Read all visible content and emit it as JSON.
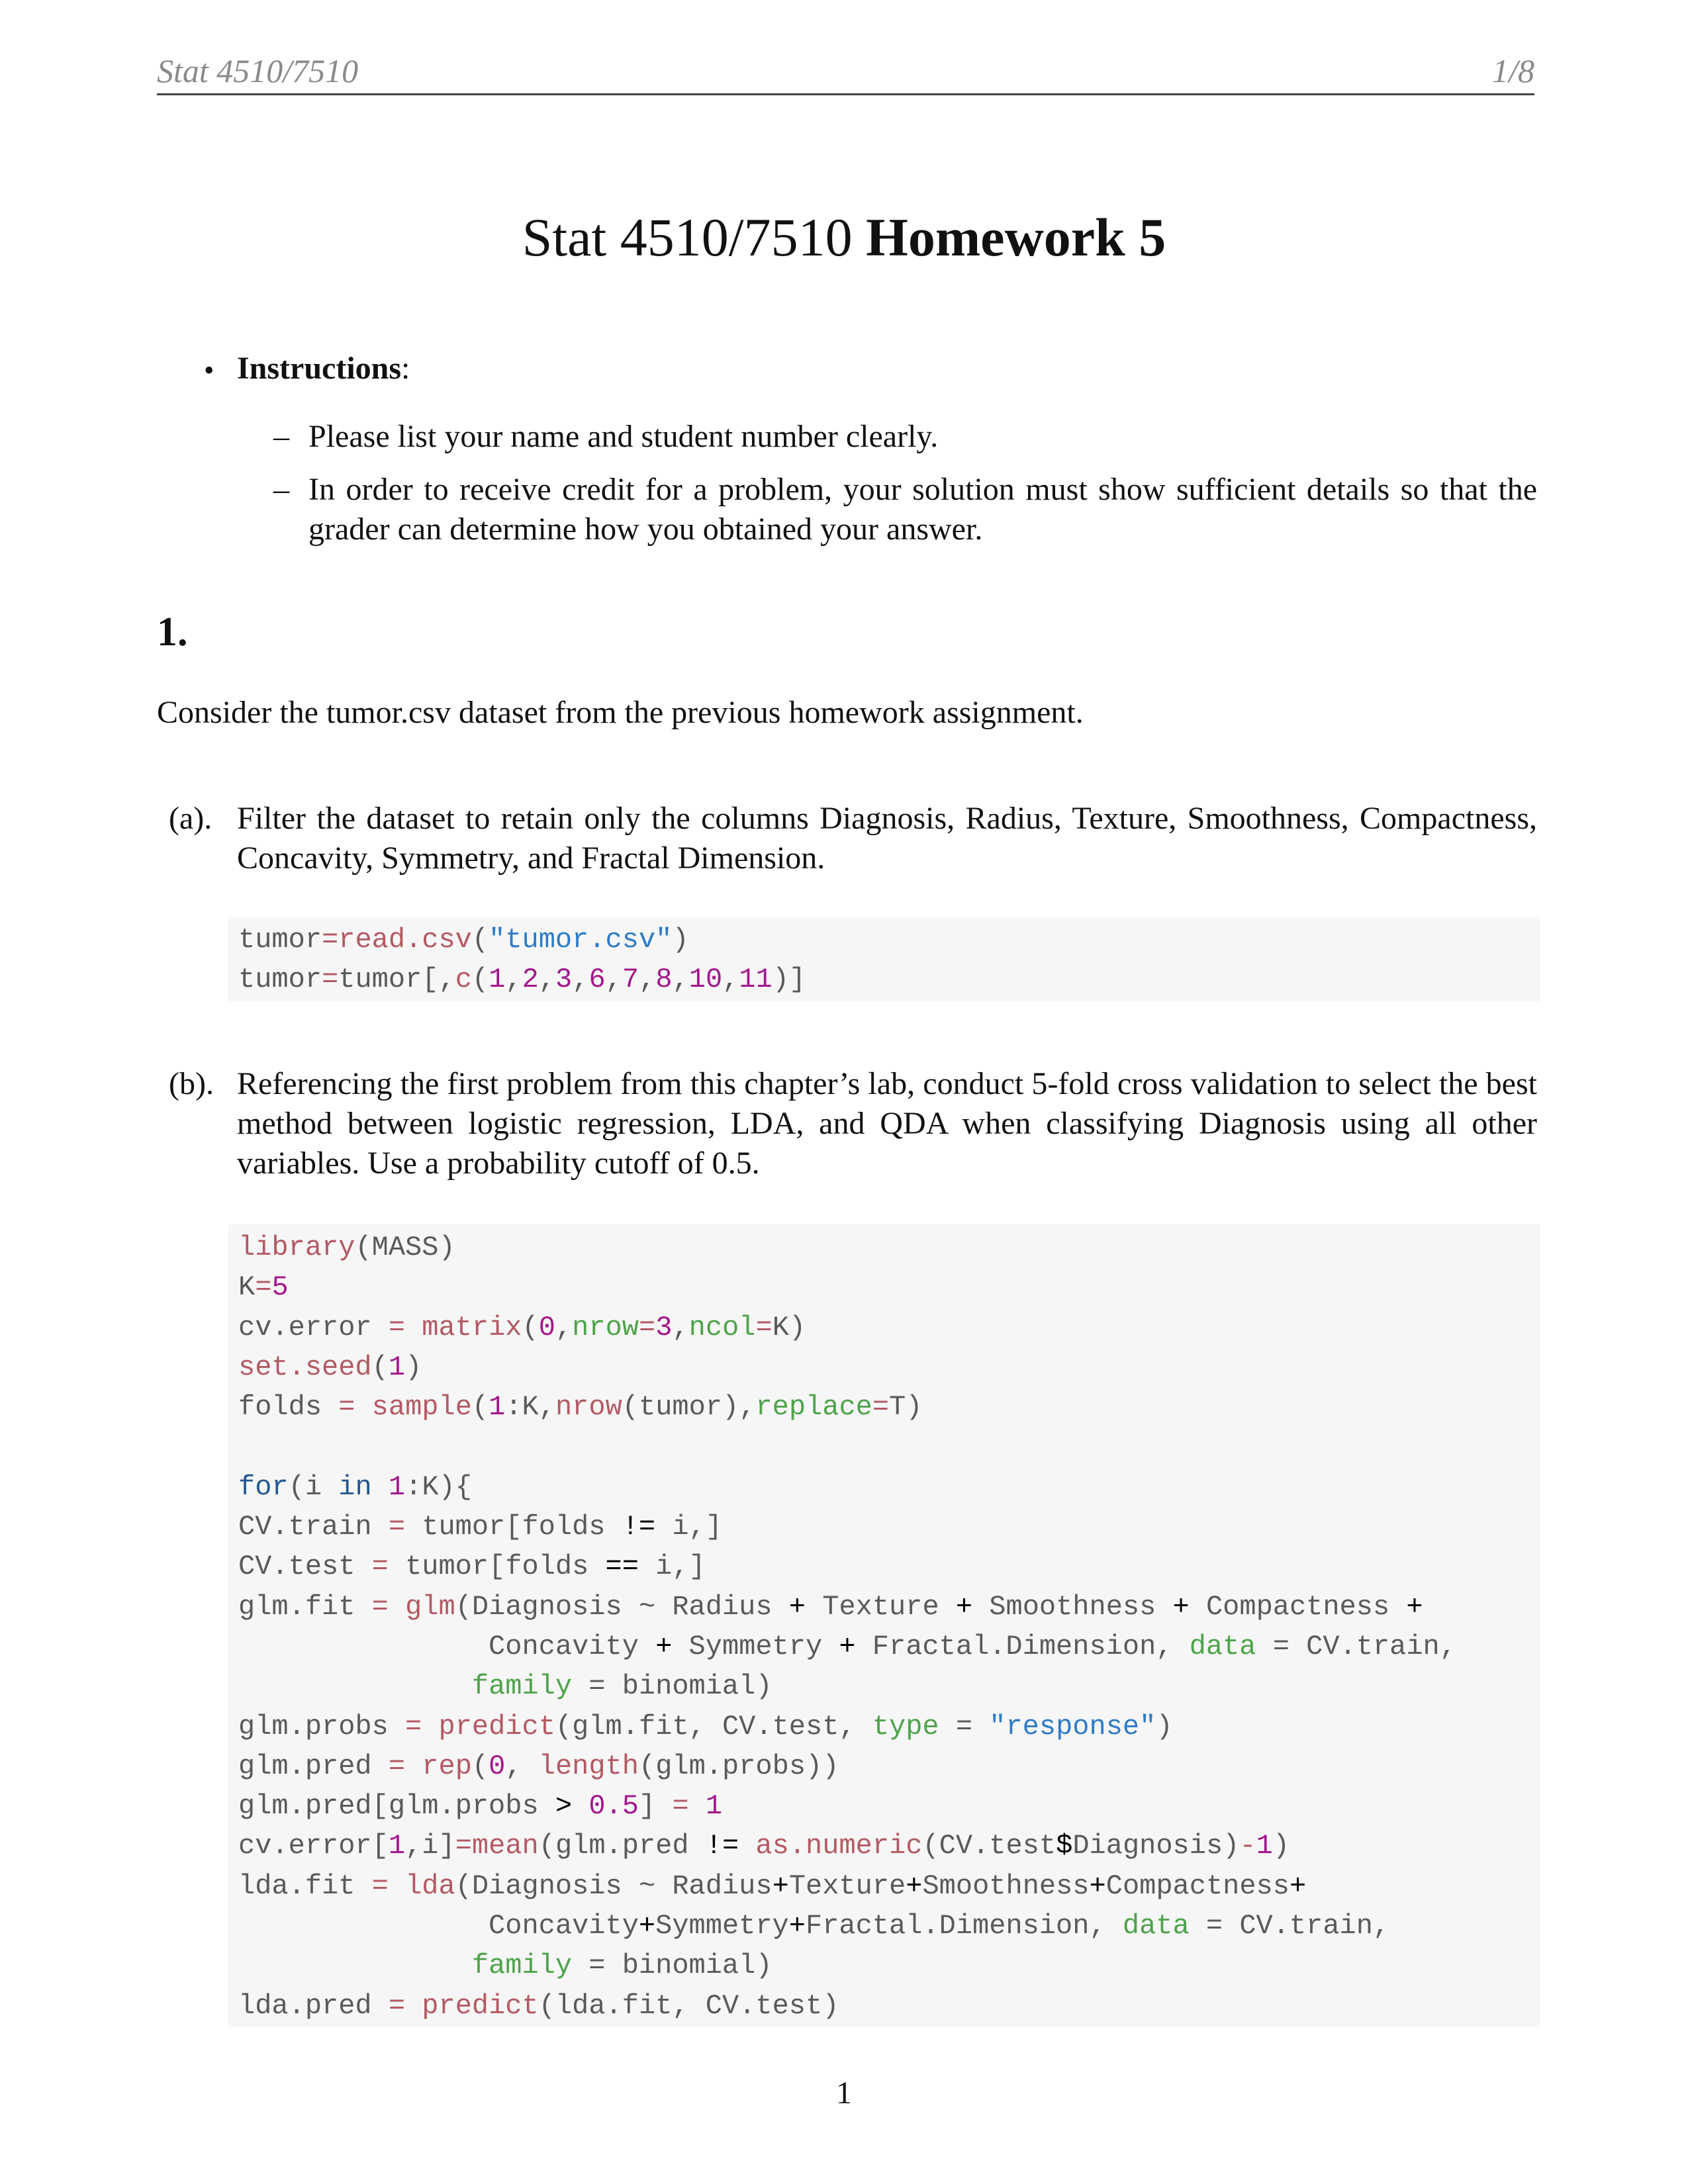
{
  "running_header": {
    "left": "Stat 4510/7510",
    "right": "1/8"
  },
  "title": {
    "course": "Stat 4510/7510",
    "assignment": "Homework 5"
  },
  "instructions": {
    "bullet": "•",
    "label": "Instructions",
    "label_suffix": ":",
    "dash": "–",
    "items": [
      "Please list your name and student number clearly.",
      "In order to receive credit for a problem, your solution must show sufficient details so that the grader can determine how you obtained your answer."
    ]
  },
  "question": {
    "number": "1.",
    "intro": "Consider the tumor.csv dataset from the previous homework assignment.",
    "parts": [
      {
        "label": "(a).",
        "text": "Filter the dataset to retain only the columns Diagnosis, Radius, Texture, Smoothness, Compactness, Concavity, Symmetry, and Fractal Dimension.",
        "code_lines": [
          [
            [
              "plain",
              "tumor"
            ],
            [
              "fn",
              "="
            ],
            [
              "fn",
              "read.csv"
            ],
            [
              "plain",
              "("
            ],
            [
              "str",
              "\"tumor.csv\""
            ],
            [
              "plain",
              ")"
            ]
          ],
          [
            [
              "plain",
              "tumor"
            ],
            [
              "fn",
              "="
            ],
            [
              "plain",
              "tumor[,"
            ],
            [
              "fn",
              "c"
            ],
            [
              "plain",
              "("
            ],
            [
              "num",
              "1"
            ],
            [
              "plain",
              ","
            ],
            [
              "num",
              "2"
            ],
            [
              "plain",
              ","
            ],
            [
              "num",
              "3"
            ],
            [
              "plain",
              ","
            ],
            [
              "num",
              "6"
            ],
            [
              "plain",
              ","
            ],
            [
              "num",
              "7"
            ],
            [
              "plain",
              ","
            ],
            [
              "num",
              "8"
            ],
            [
              "plain",
              ","
            ],
            [
              "num",
              "10"
            ],
            [
              "plain",
              ","
            ],
            [
              "num",
              "11"
            ],
            [
              "plain",
              ")]"
            ]
          ]
        ]
      },
      {
        "label": "(b).",
        "text": "Referencing the first problem from this chapter’s lab, conduct 5-fold cross validation to select the best method between logistic regression, LDA, and QDA when classifying Diagnosis using all other variables. Use a probability cutoff of 0.5.",
        "code_lines": [
          [
            [
              "fn",
              "library"
            ],
            [
              "plain",
              "(MASS)"
            ]
          ],
          [
            [
              "plain",
              "K"
            ],
            [
              "fn",
              "="
            ],
            [
              "num",
              "5"
            ]
          ],
          [
            [
              "plain",
              "cv.error "
            ],
            [
              "fn",
              "="
            ],
            [
              "plain",
              " "
            ],
            [
              "fn",
              "matrix"
            ],
            [
              "plain",
              "("
            ],
            [
              "num",
              "0"
            ],
            [
              "plain",
              ","
            ],
            [
              "arg",
              "nrow"
            ],
            [
              "fn",
              "="
            ],
            [
              "num",
              "3"
            ],
            [
              "plain",
              ","
            ],
            [
              "arg",
              "ncol"
            ],
            [
              "fn",
              "="
            ],
            [
              "plain",
              "K)"
            ]
          ],
          [
            [
              "fn",
              "set.seed"
            ],
            [
              "plain",
              "("
            ],
            [
              "num",
              "1"
            ],
            [
              "plain",
              ")"
            ]
          ],
          [
            [
              "plain",
              "folds "
            ],
            [
              "fn",
              "="
            ],
            [
              "plain",
              " "
            ],
            [
              "fn",
              "sample"
            ],
            [
              "plain",
              "("
            ],
            [
              "num",
              "1"
            ],
            [
              "plain",
              ":K,"
            ],
            [
              "fn",
              "nrow"
            ],
            [
              "plain",
              "(tumor),"
            ],
            [
              "arg",
              "replace"
            ],
            [
              "fn",
              "="
            ],
            [
              "plain",
              "T)"
            ]
          ],
          [],
          [
            [
              "kw",
              "for"
            ],
            [
              "plain",
              "(i "
            ],
            [
              "kw",
              "in"
            ],
            [
              "plain",
              " "
            ],
            [
              "num",
              "1"
            ],
            [
              "plain",
              ":K){"
            ]
          ],
          [
            [
              "plain",
              "CV.train "
            ],
            [
              "fn",
              "="
            ],
            [
              "plain",
              " tumor[folds "
            ],
            [
              "op",
              "!="
            ],
            [
              "plain",
              " i,]"
            ]
          ],
          [
            [
              "plain",
              "CV.test "
            ],
            [
              "fn",
              "="
            ],
            [
              "plain",
              " tumor[folds "
            ],
            [
              "op",
              "=="
            ],
            [
              "plain",
              " i,]"
            ]
          ],
          [
            [
              "plain",
              "glm.fit "
            ],
            [
              "fn",
              "="
            ],
            [
              "plain",
              " "
            ],
            [
              "fn",
              "glm"
            ],
            [
              "plain",
              "(Diagnosis ~ Radius "
            ],
            [
              "op",
              "+"
            ],
            [
              "plain",
              " Texture "
            ],
            [
              "op",
              "+"
            ],
            [
              "plain",
              " Smoothness "
            ],
            [
              "op",
              "+"
            ],
            [
              "plain",
              " Compactness "
            ],
            [
              "op",
              "+"
            ]
          ],
          [
            [
              "plain",
              "               Concavity "
            ],
            [
              "op",
              "+"
            ],
            [
              "plain",
              " Symmetry "
            ],
            [
              "op",
              "+"
            ],
            [
              "plain",
              " Fractal.Dimension, "
            ],
            [
              "arg",
              "data"
            ],
            [
              "plain",
              " = CV.train,"
            ]
          ],
          [
            [
              "plain",
              "              "
            ],
            [
              "arg",
              "family"
            ],
            [
              "plain",
              " = binomial)"
            ]
          ],
          [
            [
              "plain",
              "glm.probs "
            ],
            [
              "fn",
              "="
            ],
            [
              "plain",
              " "
            ],
            [
              "fn",
              "predict"
            ],
            [
              "plain",
              "(glm.fit, CV.test, "
            ],
            [
              "arg",
              "type"
            ],
            [
              "plain",
              " = "
            ],
            [
              "str",
              "\"response\""
            ],
            [
              "plain",
              ")"
            ]
          ],
          [
            [
              "plain",
              "glm.pred "
            ],
            [
              "fn",
              "="
            ],
            [
              "plain",
              " "
            ],
            [
              "fn",
              "rep"
            ],
            [
              "plain",
              "("
            ],
            [
              "num",
              "0"
            ],
            [
              "plain",
              ", "
            ],
            [
              "fn",
              "length"
            ],
            [
              "plain",
              "(glm.probs))"
            ]
          ],
          [
            [
              "plain",
              "glm.pred[glm.probs "
            ],
            [
              "op",
              ">"
            ],
            [
              "plain",
              " "
            ],
            [
              "num",
              "0.5"
            ],
            [
              "plain",
              "] "
            ],
            [
              "fn",
              "="
            ],
            [
              "plain",
              " "
            ],
            [
              "num",
              "1"
            ]
          ],
          [
            [
              "plain",
              "cv.error["
            ],
            [
              "num",
              "1"
            ],
            [
              "plain",
              ",i]"
            ],
            [
              "fn",
              "="
            ],
            [
              "fn",
              "mean"
            ],
            [
              "plain",
              "(glm.pred "
            ],
            [
              "op",
              "!="
            ],
            [
              "plain",
              " "
            ],
            [
              "fn",
              "as.numeric"
            ],
            [
              "plain",
              "(CV.test"
            ],
            [
              "op",
              "$"
            ],
            [
              "plain",
              "Diagnosis)"
            ],
            [
              "fn",
              "-"
            ],
            [
              "num",
              "1"
            ],
            [
              "plain",
              ")"
            ]
          ],
          [
            [
              "plain",
              "lda.fit "
            ],
            [
              "fn",
              "="
            ],
            [
              "plain",
              " "
            ],
            [
              "fn",
              "lda"
            ],
            [
              "plain",
              "(Diagnosis ~ Radius"
            ],
            [
              "op",
              "+"
            ],
            [
              "plain",
              "Texture"
            ],
            [
              "op",
              "+"
            ],
            [
              "plain",
              "Smoothness"
            ],
            [
              "op",
              "+"
            ],
            [
              "plain",
              "Compactness"
            ],
            [
              "op",
              "+"
            ]
          ],
          [
            [
              "plain",
              "               Concavity"
            ],
            [
              "op",
              "+"
            ],
            [
              "plain",
              "Symmetry"
            ],
            [
              "op",
              "+"
            ],
            [
              "plain",
              "Fractal.Dimension, "
            ],
            [
              "arg",
              "data"
            ],
            [
              "plain",
              " = CV.train,"
            ]
          ],
          [
            [
              "plain",
              "              "
            ],
            [
              "arg",
              "family"
            ],
            [
              "plain",
              " = binomial)"
            ]
          ],
          [
            [
              "plain",
              "lda.pred "
            ],
            [
              "fn",
              "="
            ],
            [
              "plain",
              " "
            ],
            [
              "fn",
              "predict"
            ],
            [
              "plain",
              "(lda.fit, CV.test)"
            ]
          ]
        ]
      }
    ]
  },
  "colors": {
    "code_background": "#f6f6f6",
    "code_default": "#5a5a5a",
    "code_function": "#b35a64",
    "code_number": "#a2188c",
    "code_argument": "#4ea34a",
    "code_string": "#2e7bc6",
    "code_keyword": "#23598f",
    "code_operator": "#000000",
    "header_text": "#8a8a8a"
  },
  "footer": {
    "page_number": "1"
  }
}
